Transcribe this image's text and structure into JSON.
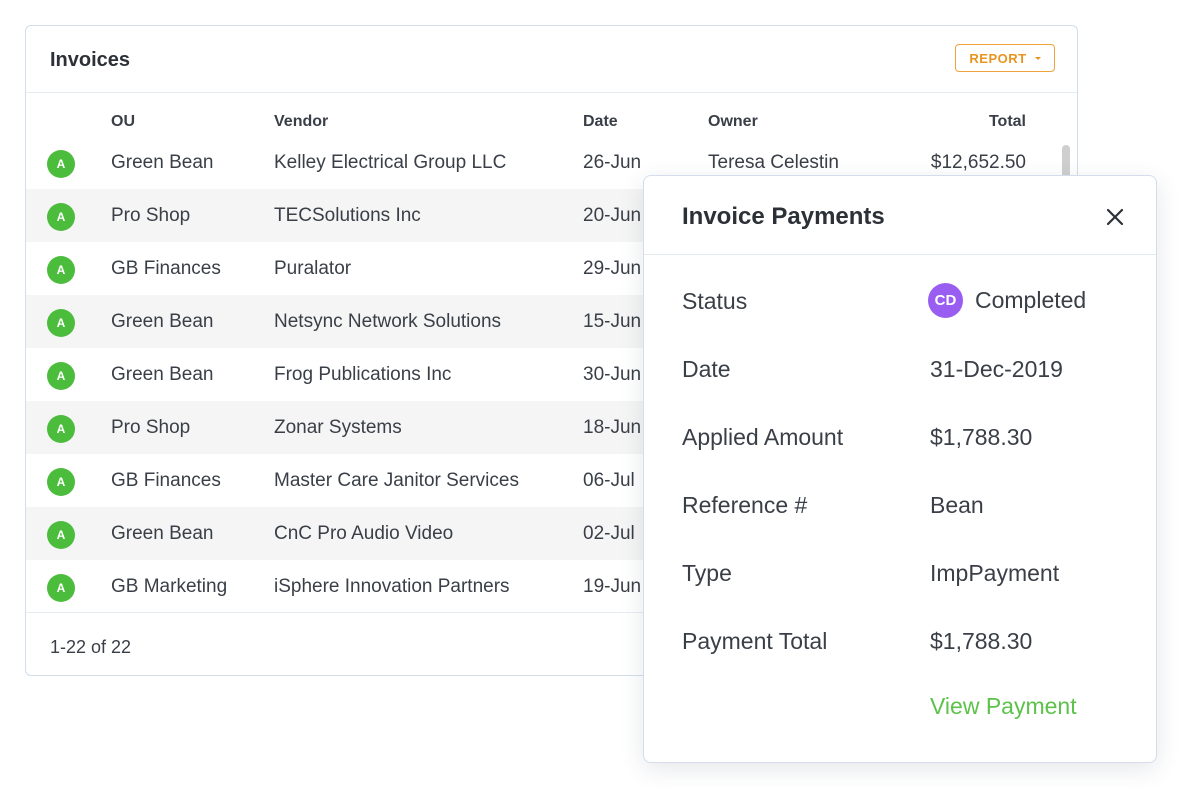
{
  "invoices": {
    "title": "Invoices",
    "report_label": "REPORT",
    "columns": {
      "ou": "OU",
      "vendor": "Vendor",
      "date": "Date",
      "owner": "Owner",
      "total": "Total"
    },
    "rows": [
      {
        "avatar": "A",
        "ou": "Green Bean",
        "vendor": "Kelley Electrical Group LLC",
        "date": "26-Jun",
        "owner": "Teresa Celestin",
        "total": "$12,652.50"
      },
      {
        "avatar": "A",
        "ou": "Pro Shop",
        "vendor": "TECSolutions Inc",
        "date": "20-Jun",
        "owner": "",
        "total": ""
      },
      {
        "avatar": "A",
        "ou": "GB Finances",
        "vendor": "Puralator",
        "date": "29-Jun",
        "owner": "",
        "total": ""
      },
      {
        "avatar": "A",
        "ou": "Green Bean",
        "vendor": "Netsync Network Solutions",
        "date": "15-Jun",
        "owner": "",
        "total": ""
      },
      {
        "avatar": "A",
        "ou": "Green Bean",
        "vendor": "Frog Publications Inc",
        "date": "30-Jun",
        "owner": "",
        "total": ""
      },
      {
        "avatar": "A",
        "ou": "Pro Shop",
        "vendor": "Zonar Systems",
        "date": "18-Jun",
        "owner": "",
        "total": ""
      },
      {
        "avatar": "A",
        "ou": "GB Finances",
        "vendor": "Master Care Janitor Services",
        "date": "06-Jul",
        "owner": "",
        "total": ""
      },
      {
        "avatar": "A",
        "ou": "Green Bean",
        "vendor": "CnC Pro Audio Video",
        "date": "02-Jul",
        "owner": "",
        "total": ""
      },
      {
        "avatar": "A",
        "ou": "GB Marketing",
        "vendor": "iSphere Innovation Partners",
        "date": "19-Jun",
        "owner": "",
        "total": ""
      }
    ],
    "pagination": "1-22 of 22"
  },
  "payment_popover": {
    "title": "Invoice Payments",
    "status": {
      "label": "Status",
      "badge": "CD",
      "value": "Completed"
    },
    "date": {
      "label": "Date",
      "value": "31-Dec-2019"
    },
    "applied_amount": {
      "label": "Applied Amount",
      "value": "$1,788.30"
    },
    "reference": {
      "label": "Reference #",
      "value": "Bean"
    },
    "type": {
      "label": "Type",
      "value": "ImpPayment"
    },
    "payment_total": {
      "label": "Payment Total",
      "value": "$1,788.30"
    },
    "view_link": "View Payment"
  },
  "colors": {
    "accent_orange": "#e8951f",
    "avatar_green": "#4cbc3c",
    "badge_purple": "#9a5df1",
    "link_green": "#5cc24a"
  }
}
